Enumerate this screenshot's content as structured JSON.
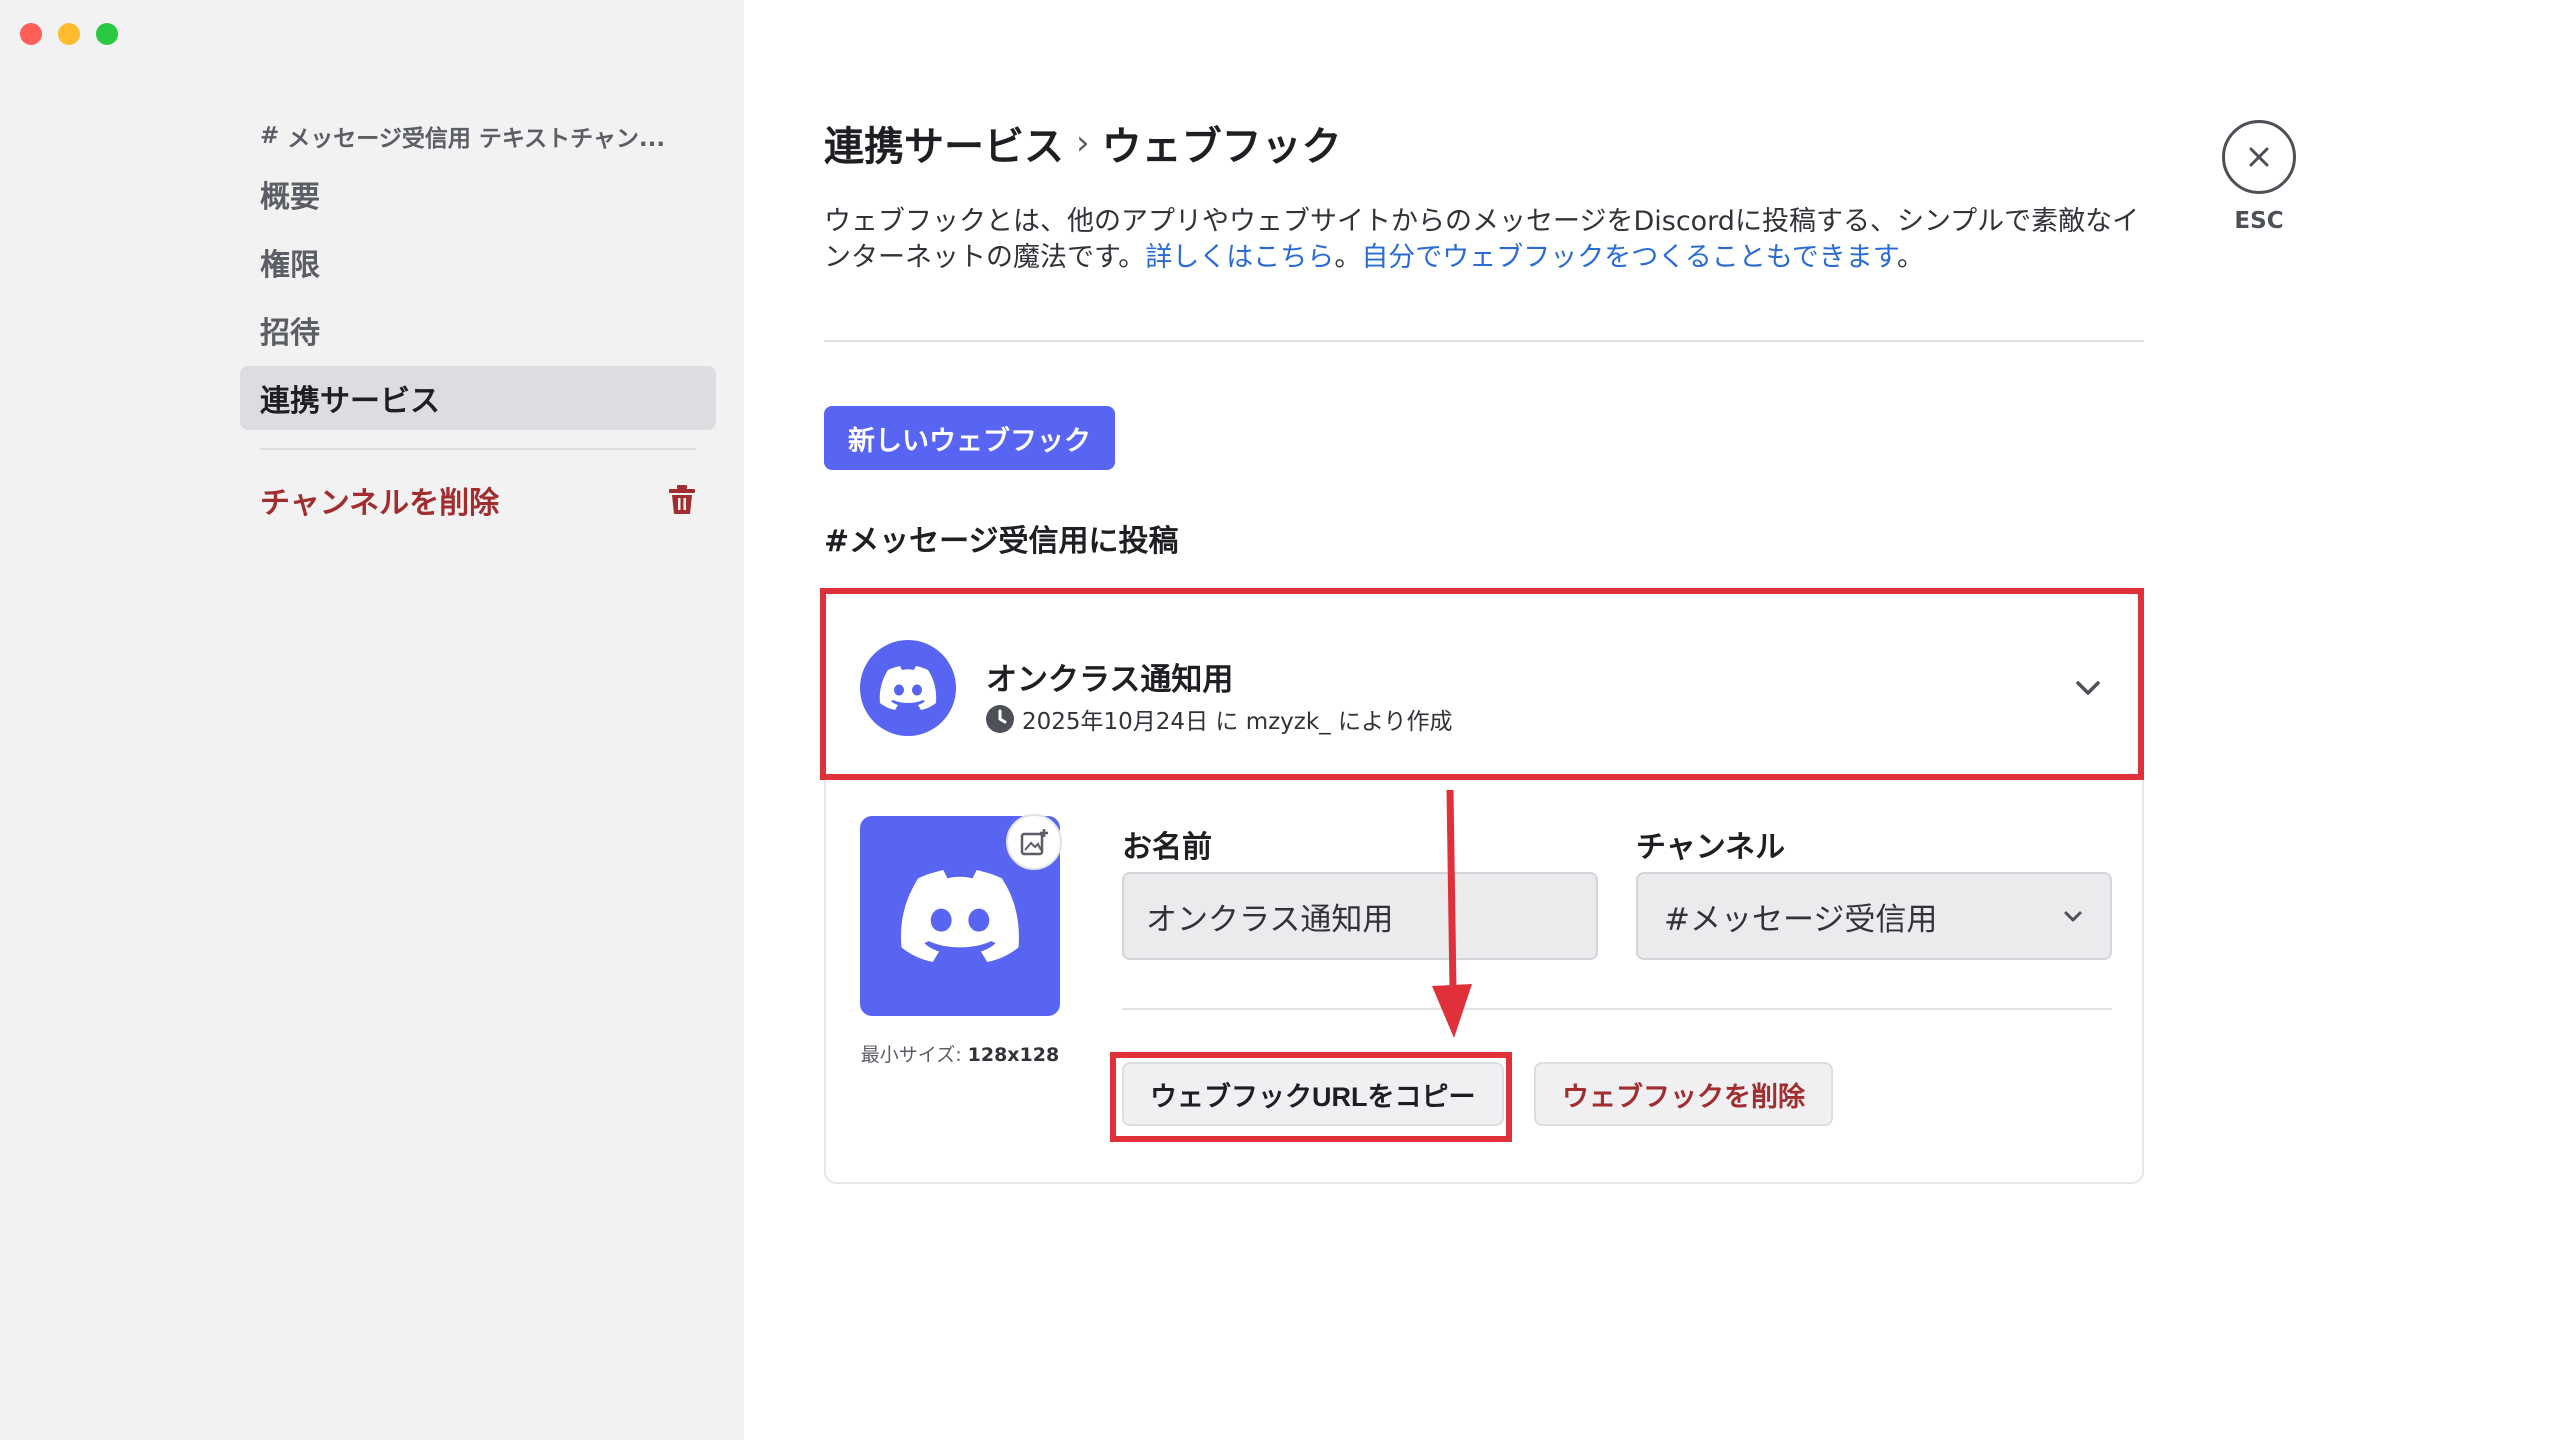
{
  "sidebar": {
    "channel_header": "メッセージ受信用 テキストチャン...",
    "items": [
      {
        "label": "概要"
      },
      {
        "label": "権限"
      },
      {
        "label": "招待"
      },
      {
        "label": "連携サービス"
      }
    ],
    "delete_channel": "チャンネルを削除"
  },
  "page": {
    "breadcrumb_parent": "連携サービス",
    "breadcrumb_sep": "›",
    "breadcrumb_current": "ウェブフック",
    "desc_part1": "ウェブフックとは、他のアプリやウェブサイトからのメッセージをDiscordに投稿する、シンプルで素敵なインターネットの魔法です。",
    "desc_link1": "詳しくはこちら",
    "desc_part2": "。",
    "desc_link2": "自分でウェブフックをつくることもできます",
    "desc_part3": "。",
    "new_webhook_button": "新しいウェブフック",
    "section_label": "#メッセージ受信用に投稿"
  },
  "webhook": {
    "name": "オンクラス通知用",
    "created_meta": "2025年10月24日 に mzyzk_ により作成",
    "name_label": "お名前",
    "name_value": "オンクラス通知用",
    "channel_label": "チャンネル",
    "channel_value": "#メッセージ受信用",
    "min_size_prefix": "最小サイズ: ",
    "min_size_value": "128x128",
    "copy_url_button": "ウェブフックURLをコピー",
    "delete_button": "ウェブフックを削除"
  },
  "close": {
    "esc_label": "ESC"
  },
  "colors": {
    "blurple": "#5865f2",
    "danger": "#a12d2f",
    "link": "#2a6cd6",
    "annotation": "#e0303a"
  }
}
